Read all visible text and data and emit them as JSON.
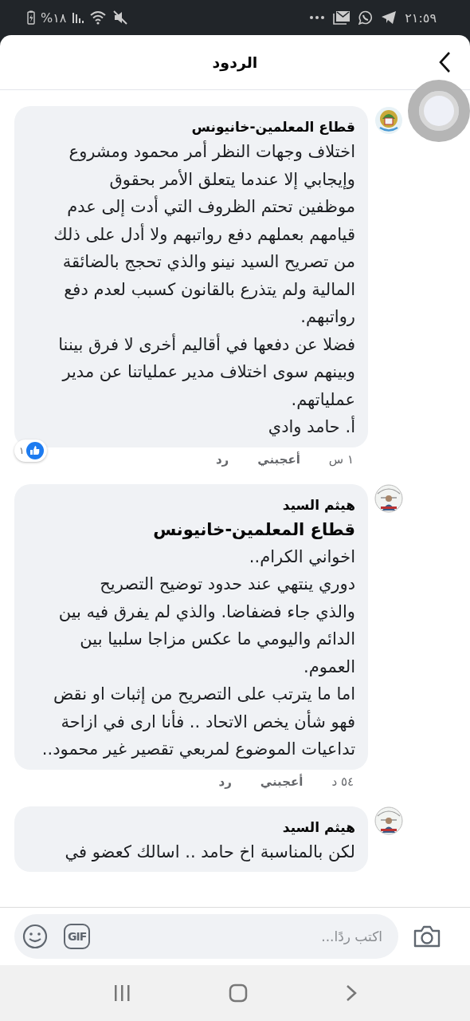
{
  "status_bar": {
    "time": "٢١:٥٩",
    "battery": "%١٨"
  },
  "header": {
    "title": "الردود"
  },
  "comments": [
    {
      "author": "قطاع المعلمين-خانيونس",
      "avatar": {
        "kind": "logo"
      },
      "lines": [
        {
          "kind": "text",
          "text": "اختلاف وجهات النظر أمر محمود ومشروع"
        },
        {
          "kind": "text",
          "text": "وإيجابي إلا عندما يتعلق الأمر بحقوق"
        },
        {
          "kind": "text",
          "text": "موظفين تحتم الظروف التي أدت إلى عدم"
        },
        {
          "kind": "text",
          "text": "قيامهم بعملهم دفع رواتبهم ولا أدل على ذلك"
        },
        {
          "kind": "text",
          "text": "من تصريح السيد نينو والذي تحجج بالضائقة"
        },
        {
          "kind": "text",
          "text": "المالية ولم يتذرع بالقانون كسبب لعدم دفع"
        },
        {
          "kind": "text",
          "text": "رواتبهم."
        },
        {
          "kind": "text",
          "text": "فضلا عن دفعها في أقاليم أخرى لا فرق بيننا"
        },
        {
          "kind": "text",
          "text": "وبينهم سوى اختلاف مدير عملياتنا عن مدير"
        },
        {
          "kind": "text",
          "text": "عملياتهم."
        },
        {
          "kind": "text",
          "text": "أ. حامد وادي"
        }
      ],
      "time": "١ س",
      "like": "أعجبني",
      "reply": "رد",
      "reactions": {
        "count": "١"
      }
    },
    {
      "author": "هيثم السيد",
      "lines": [
        {
          "kind": "mention",
          "text": "قطاع المعلمين-خانيونس"
        },
        {
          "kind": "text",
          "text": "اخواني الكرام.."
        },
        {
          "kind": "text",
          "text": "دوري ينتهي عند حدود توضيح التصريح"
        },
        {
          "kind": "text",
          "text": "والذي جاء فضفاضا. والذي لم يفرق فيه بين"
        },
        {
          "kind": "text",
          "text": "الدائم واليومي ما عكس مزاجا سلبيا بين"
        },
        {
          "kind": "text",
          "text": "العموم."
        },
        {
          "kind": "text",
          "text": "اما ما يترتب على التصريح من إثبات او نقض"
        },
        {
          "kind": "text",
          "text": "فهو شأن يخص الاتحاد .. فأنا ارى في ازاحة"
        },
        {
          "kind": "text",
          "text": "تداعيات الموضوع لمربعي تقصير غير محمود.."
        }
      ],
      "time": "٥٤ د",
      "like": "أعجبني",
      "reply": "رد"
    },
    {
      "author": "هيثم السيد",
      "lines": [
        {
          "kind": "text",
          "text": "لكن بالمناسبة اخ حامد ..  اسالك كعضو في"
        }
      ]
    }
  ],
  "composer": {
    "placeholder": "اكتب ردًا...",
    "gif": "GIF"
  }
}
